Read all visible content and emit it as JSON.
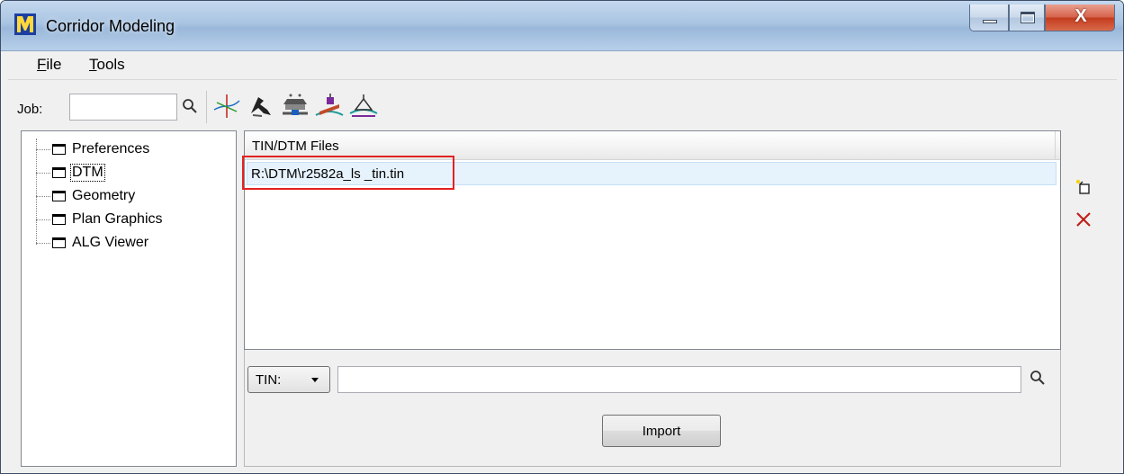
{
  "window": {
    "title": "Corridor Modeling",
    "close_glyph": "X"
  },
  "menu": {
    "file": {
      "accel": "F",
      "rest": "ile"
    },
    "tools": {
      "accel": "T",
      "rest": "ools"
    }
  },
  "toolbar": {
    "job_label": "Job:",
    "job_value": "",
    "icons": [
      "search-icon",
      "alignment-icon",
      "template-icon",
      "corridor-icon",
      "superelevation-icon",
      "cross-section-icon"
    ]
  },
  "tree": {
    "items": [
      {
        "label": "Preferences",
        "selected": false
      },
      {
        "label": "DTM",
        "selected": true
      },
      {
        "label": "Geometry",
        "selected": false
      },
      {
        "label": "Plan Graphics",
        "selected": false
      },
      {
        "label": "ALG Viewer",
        "selected": false
      }
    ]
  },
  "files": {
    "header": "TIN/DTM Files",
    "rows": [
      {
        "path": "R:\\DTM\\r2582a_ls _tin.tin"
      }
    ],
    "highlight_color": "#e32222"
  },
  "import": {
    "type_value": "TIN:",
    "path_value": "",
    "button_label": "Import"
  },
  "colors": {
    "titlebar": "#a9c4e2",
    "close_button": "#c43c1f",
    "selected_row": "#e6f2fc"
  }
}
